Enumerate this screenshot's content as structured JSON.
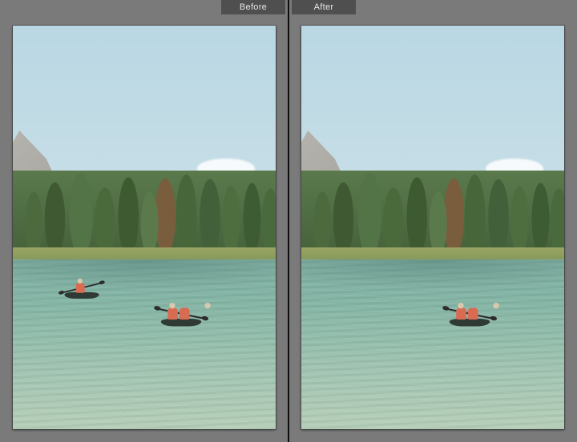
{
  "tabs": {
    "before": "Before",
    "after": "After"
  },
  "panels": {
    "before": {
      "kayaks": {
        "left": true,
        "right": true
      }
    },
    "after": {
      "kayaks": {
        "left": false,
        "right": true
      }
    }
  }
}
